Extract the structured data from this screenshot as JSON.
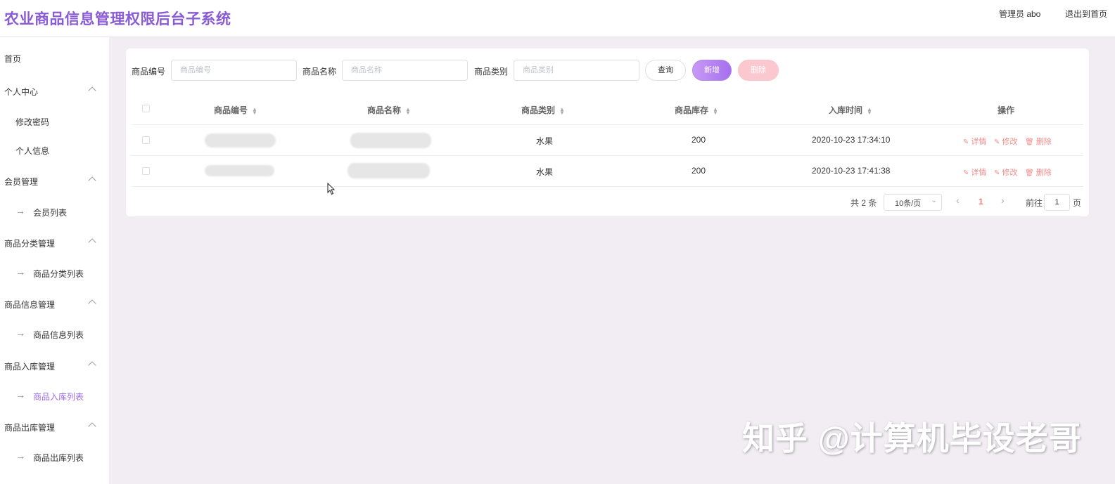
{
  "header": {
    "title": "农业商品信息管理权限后台子系统",
    "admin": "管理员 abo",
    "exit": "退出到首页"
  },
  "sidebar": {
    "home": "首页",
    "groups": [
      {
        "label": "个人中心",
        "items": [
          "修改密码",
          "个人信息"
        ]
      },
      {
        "label": "会员管理",
        "items": [
          "会员列表"
        ]
      },
      {
        "label": "商品分类管理",
        "items": [
          "商品分类列表"
        ]
      },
      {
        "label": "商品信息管理",
        "items": [
          "商品信息列表"
        ]
      },
      {
        "label": "商品入库管理",
        "items": [
          "商品入库列表"
        ]
      },
      {
        "label": "商品出库管理",
        "items": [
          "商品出库列表"
        ]
      }
    ],
    "active_item": "商品入库列表"
  },
  "search": {
    "code_label": "商品编号",
    "code_placeholder": "商品编号",
    "name_label": "商品名称",
    "name_placeholder": "商品名称",
    "category_label": "商品类别",
    "category_placeholder": "商品类别",
    "query_button": "查询",
    "add_button": "新增",
    "delete_button": "删除"
  },
  "table": {
    "columns": [
      "商品编号",
      "商品名称",
      "商品类别",
      "商品库存",
      "入库时间",
      "操作"
    ],
    "rows": [
      {
        "category": "水果",
        "stock": "200",
        "time": "2020-10-23 17:34:10"
      },
      {
        "category": "水果",
        "stock": "200",
        "time": "2020-10-23 17:41:38"
      }
    ],
    "actions": {
      "detail": "详情",
      "edit": "修改",
      "delete": "删除"
    }
  },
  "pagination": {
    "total": "共 2 条",
    "page_size": "10条/页",
    "current_page": "1",
    "goto_label": "前往",
    "goto_value": "1",
    "page_unit": "页"
  },
  "watermark": "知乎 @计算机毕设老哥",
  "colors": {
    "accent": "#8a5bd6",
    "danger_light": "#fcc8d0",
    "action_text": "#f08c8c",
    "background": "#f1edf3"
  }
}
